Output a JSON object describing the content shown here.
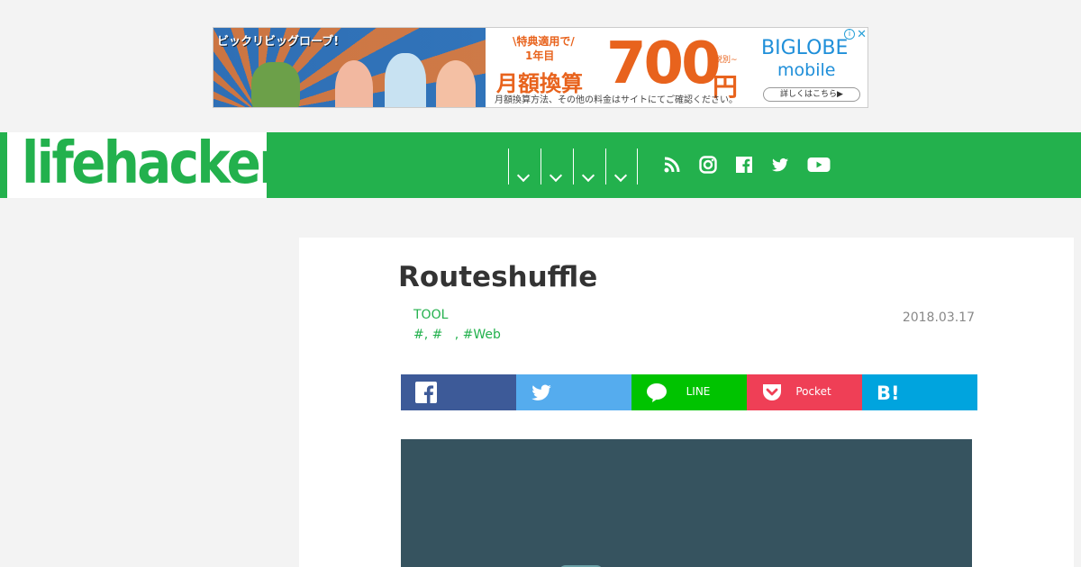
{
  "ad": {
    "tagline": "ビックリビッグローブ!",
    "line1": "\\特典適用で/",
    "line2": "1年目",
    "line3": "月額換算",
    "big_number": "700",
    "unit": "円",
    "small_note": "税別~",
    "disclaimer": "月額換算方法、その他の料金はサイトにてご確認ください。",
    "brand": "BIGLOBE",
    "product": "mobile",
    "cta": "詳しくはこちら▶",
    "info_icon": "info-icon",
    "close_icon": "close-icon"
  },
  "header": {
    "logo": "lifehacker",
    "accent_color": "#23b14d",
    "nav_icons": [
      "chevron-down-icon",
      "chevron-down-icon",
      "chevron-down-icon",
      "chevron-down-icon"
    ],
    "social_icons": [
      "rss-icon",
      "instagram-icon",
      "facebook-icon",
      "twitter-icon",
      "youtube-icon"
    ]
  },
  "article": {
    "title": "Routeshuffle",
    "category": "TOOL",
    "tags": "#, #   , #Web",
    "date": "2018.03.17"
  },
  "share": {
    "buttons": [
      {
        "name": "facebook",
        "label": "",
        "color": "#3d5a98"
      },
      {
        "name": "twitter",
        "label": "",
        "color": "#55acee"
      },
      {
        "name": "line",
        "label": "LINE",
        "color": "#00c300"
      },
      {
        "name": "pocket",
        "label": "Pocket",
        "color": "#ef3f56"
      },
      {
        "name": "hatena",
        "label": "",
        "color": "#00a4de"
      }
    ]
  }
}
